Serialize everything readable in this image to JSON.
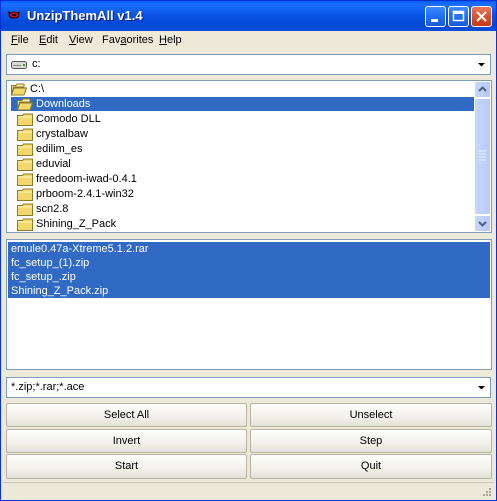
{
  "window": {
    "title": "UnzipThemAll v1.4",
    "brand_color": "#0a54e4"
  },
  "titlebar": {
    "minimize_icon": "minimize-icon",
    "maximize_icon": "maximize-icon",
    "close_icon": "close-icon"
  },
  "menu": [
    {
      "label": "File",
      "hotkey": "F",
      "rest": "ile"
    },
    {
      "label": "Edit",
      "hotkey": "E",
      "rest": "dit"
    },
    {
      "label": "View",
      "hotkey": "V",
      "rest": "iew"
    },
    {
      "label": "Favorites",
      "hotkey": "a",
      "pre": "Fav",
      "rest": "orites"
    },
    {
      "label": "Help",
      "hotkey": "H",
      "rest": "elp"
    }
  ],
  "drive": {
    "value": "c:",
    "icon": "drive-icon"
  },
  "directories": {
    "root": "C:\\",
    "items": [
      "Downloads",
      "Comodo DLL",
      "crystalbaw",
      "edilim_es",
      "eduvial",
      "freedoom-iwad-0.4.1",
      "prboom-2.4.1-win32",
      "scn2.8",
      "Shining_Z_Pack"
    ],
    "selected": "Downloads"
  },
  "files": {
    "items": [
      "emule0.47a-Xtreme5.1.2.rar",
      "fc_setup_(1).zip",
      "fc_setup_.zip",
      "Shining_Z_Pack.zip"
    ],
    "selection_color": "#316ac5"
  },
  "filter": {
    "value": "*.zip;*.rar;*.ace"
  },
  "buttons": {
    "select_all": "Select All",
    "unselect": "Unselect",
    "invert": "Invert",
    "step": "Step",
    "start": "Start",
    "quit": "Quit"
  },
  "statusbar": {
    "text": ""
  }
}
